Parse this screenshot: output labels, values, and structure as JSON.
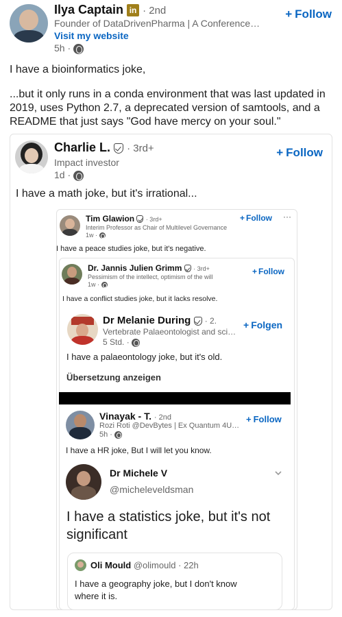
{
  "post": {
    "author": {
      "name": "Ilya Captain",
      "degree": "· 2nd",
      "headline": "Founder of DataDrivenPharma | A Conference…",
      "website_link": "Visit my website",
      "time": "5h ·"
    },
    "follow_label": "Follow",
    "text_1": "I have a bioinformatics joke,",
    "text_2": "...but it only runs in a conda environment that was last updated in 2019, uses Python 2.7, a deprecated version of samtools, and a README that just says \"God have mercy on your soul.\""
  },
  "share1": {
    "author": {
      "name": "Charlie L.",
      "degree": "· 3rd+",
      "headline": "Impact investor",
      "time": "1d ·"
    },
    "follow_label": "Follow",
    "text": "I have a math joke, but it's irrational..."
  },
  "share2": {
    "author": {
      "name": "Tim Glawion",
      "degree": "· 3rd+",
      "headline": "Interim Professor as Chair of Multilevel Governance",
      "time": "1w ·"
    },
    "follow_label": "Follow",
    "more_label": "···",
    "text": "I have a peace studies joke, but it's negative."
  },
  "share3": {
    "author": {
      "name": "Dr. Jannis Julien Grimm",
      "degree": "· 3rd+",
      "headline": "Pessimism of the intellect, optimism of the will",
      "time": "1w ·"
    },
    "follow_label": "Follow",
    "text": "I have a conflict studies joke, but it lacks resolve."
  },
  "share4": {
    "author": {
      "name": "Dr Melanie During",
      "degree": "· 2.",
      "headline": "Vertebrate Palaeontologist and scie…",
      "time": "5 Std. ·"
    },
    "follow_label": "Folgen",
    "text": "I have a palaeontology joke, but it's old.",
    "translate_label": "Übersetzung anzeigen"
  },
  "share5": {
    "author": {
      "name": "Vinayak - T.",
      "degree": "· 2nd",
      "headline": "Rozi Roti @DevBytes | Ex Quantum 4U |…",
      "time": "5h ·"
    },
    "follow_label": "Follow",
    "text": "I have a HR joke, But I will let you know."
  },
  "tweet1": {
    "name": "Dr Michele V",
    "handle": "@micheleveldsman",
    "text": "I have a statistics joke, but it's not significant"
  },
  "tweet2": {
    "name": "Oli Mould",
    "handle": "@olimould · 22h",
    "text": "I have a geography joke, but I don't know where it is."
  },
  "colors": {
    "accent": "#0a66c2",
    "linkedin_badge": "#a07f1a",
    "redaction_bar": "#000000"
  }
}
